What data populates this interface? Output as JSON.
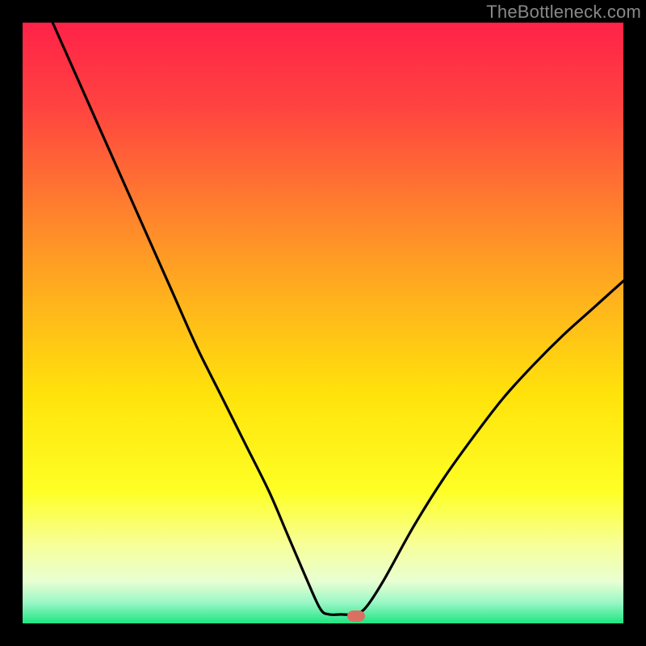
{
  "attribution": "TheBottleneck.com",
  "chart_data": {
    "type": "line",
    "title": "",
    "xlabel": "",
    "ylabel": "",
    "xlim": [
      0,
      100
    ],
    "ylim": [
      0,
      100
    ],
    "background_gradient_stops": [
      {
        "offset": 0.0,
        "color": "#ff2248"
      },
      {
        "offset": 0.14,
        "color": "#ff4340"
      },
      {
        "offset": 0.3,
        "color": "#ff7c2f"
      },
      {
        "offset": 0.46,
        "color": "#ffb21d"
      },
      {
        "offset": 0.62,
        "color": "#ffe30b"
      },
      {
        "offset": 0.78,
        "color": "#feff25"
      },
      {
        "offset": 0.87,
        "color": "#f7ff9a"
      },
      {
        "offset": 0.93,
        "color": "#e8ffd2"
      },
      {
        "offset": 0.965,
        "color": "#9bf7c6"
      },
      {
        "offset": 1.0,
        "color": "#1ee582"
      }
    ],
    "series": [
      {
        "name": "bottleneck-curve",
        "color": "#000000",
        "x": [
          5,
          9,
          13,
          17,
          21,
          25,
          29,
          33,
          37,
          41,
          44,
          47,
          49.5,
          51,
          53,
          55,
          57,
          60,
          65,
          70,
          75,
          80,
          85,
          90,
          95,
          100
        ],
        "y": [
          100,
          91,
          82,
          73,
          64,
          55,
          46,
          38,
          30,
          22,
          15,
          8,
          2.5,
          1.5,
          1.5,
          1.5,
          2.5,
          7,
          16,
          24,
          31,
          37.5,
          43,
          48,
          52.5,
          57
        ]
      }
    ],
    "marker": {
      "x": 55.5,
      "y": 1.2,
      "color": "#dc6f63"
    }
  }
}
